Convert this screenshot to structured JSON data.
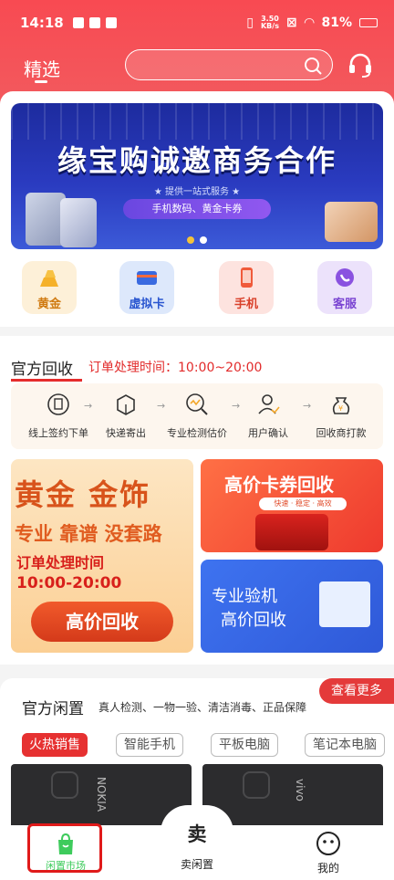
{
  "status_bar": {
    "time": "14:18",
    "net_speed_value": "3.50",
    "net_speed_unit": "KB/s",
    "battery": "81%"
  },
  "header": {
    "tab_title": "精选",
    "search_placeholder": ""
  },
  "banner": {
    "title": "缘宝购诚邀商务合作",
    "subtitle": "★ 提供一站式服务 ★",
    "pill": "手机数码、黄金卡券",
    "dots": 2
  },
  "categories": [
    {
      "label": "黄金",
      "icon": "gold-bar-icon",
      "bg": "#fdf0d8",
      "color": "#d07a10"
    },
    {
      "label": "虚拟卡",
      "icon": "virtual-card-icon",
      "bg": "#dde8fb",
      "color": "#2a56d0"
    },
    {
      "label": "手机",
      "icon": "phone-icon",
      "bg": "#fde3df",
      "color": "#d9402a"
    },
    {
      "label": "客服",
      "icon": "service-icon",
      "bg": "#ece2fb",
      "color": "#7a44d2"
    }
  ],
  "recycle": {
    "title": "官方回收",
    "hours": "订单处理时间：10:00~20:00",
    "steps": [
      "线上签约下单",
      "快递寄出",
      "专业检测估价",
      "用户确认",
      "回收商打款"
    ]
  },
  "gold_card": {
    "line1": "黄金 金饰",
    "line2": "专业 靠谱 没套路",
    "line3": "订单处理时间",
    "line4": "10:00-20:00",
    "button": "高价回收"
  },
  "card_voucher": {
    "title": "高价卡券回收",
    "tags": "快速 · 稳定 · 高效"
  },
  "card_inspect": {
    "line1": "专业验机",
    "line2": "高价回收"
  },
  "idle": {
    "more": "查看更多",
    "title": "官方闲置",
    "subtitle": "真人检测、一物一验、清洁消毒、正品保障",
    "chips": [
      "火热销售",
      "智能手机",
      "平板电脑",
      "笔记本电脑"
    ],
    "product_brands": [
      "NOKIA",
      "vivo"
    ]
  },
  "bottom_nav": [
    {
      "label": "闲置市场"
    },
    {
      "label": "卖闲置",
      "icon_text": "卖"
    },
    {
      "label": "我的"
    }
  ],
  "colors": {
    "brand_red": "#f24a4f",
    "accent_red": "#e52c2c"
  }
}
